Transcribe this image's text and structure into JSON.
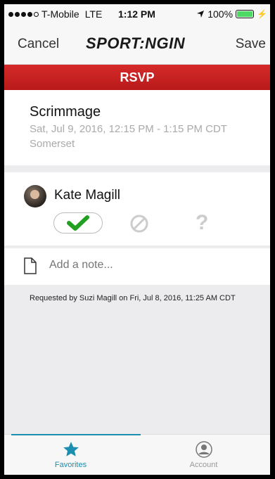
{
  "status_bar": {
    "carrier": "T-Mobile",
    "network": "LTE",
    "time": "1:12 PM",
    "battery": "100%",
    "battery_level": 1.0,
    "signal_bars": 4
  },
  "nav": {
    "cancel_label": "Cancel",
    "logo_text": "SPORT:NGIN",
    "save_label": "Save"
  },
  "header": {
    "title": "RSVP",
    "color": "#c92222"
  },
  "event": {
    "title": "Scrimmage",
    "when": "Sat, Jul 9, 2016, 12:15 PM - 1:15 PM CDT",
    "where": "Somerset"
  },
  "player": {
    "name": "Kate Magill",
    "selected_response": "yes",
    "responses": [
      {
        "id": "yes",
        "icon": "checkmark-icon",
        "color": "#22a022"
      },
      {
        "id": "no",
        "icon": "no-entry-icon",
        "color": "#cccccc"
      },
      {
        "id": "maybe",
        "icon": "question-mark-icon",
        "label": "?",
        "color": "#cccccc"
      }
    ]
  },
  "note": {
    "placeholder": "Add a note...",
    "value": ""
  },
  "request_info": "Requested by Suzi Magill on Fri, Jul 8, 2016, 11:25 AM CDT",
  "tabs": [
    {
      "label": "Favorites",
      "icon": "star-icon",
      "active": true
    },
    {
      "label": "Account",
      "icon": "user-icon",
      "active": false
    }
  ],
  "accent_color": "#1b8fb0"
}
